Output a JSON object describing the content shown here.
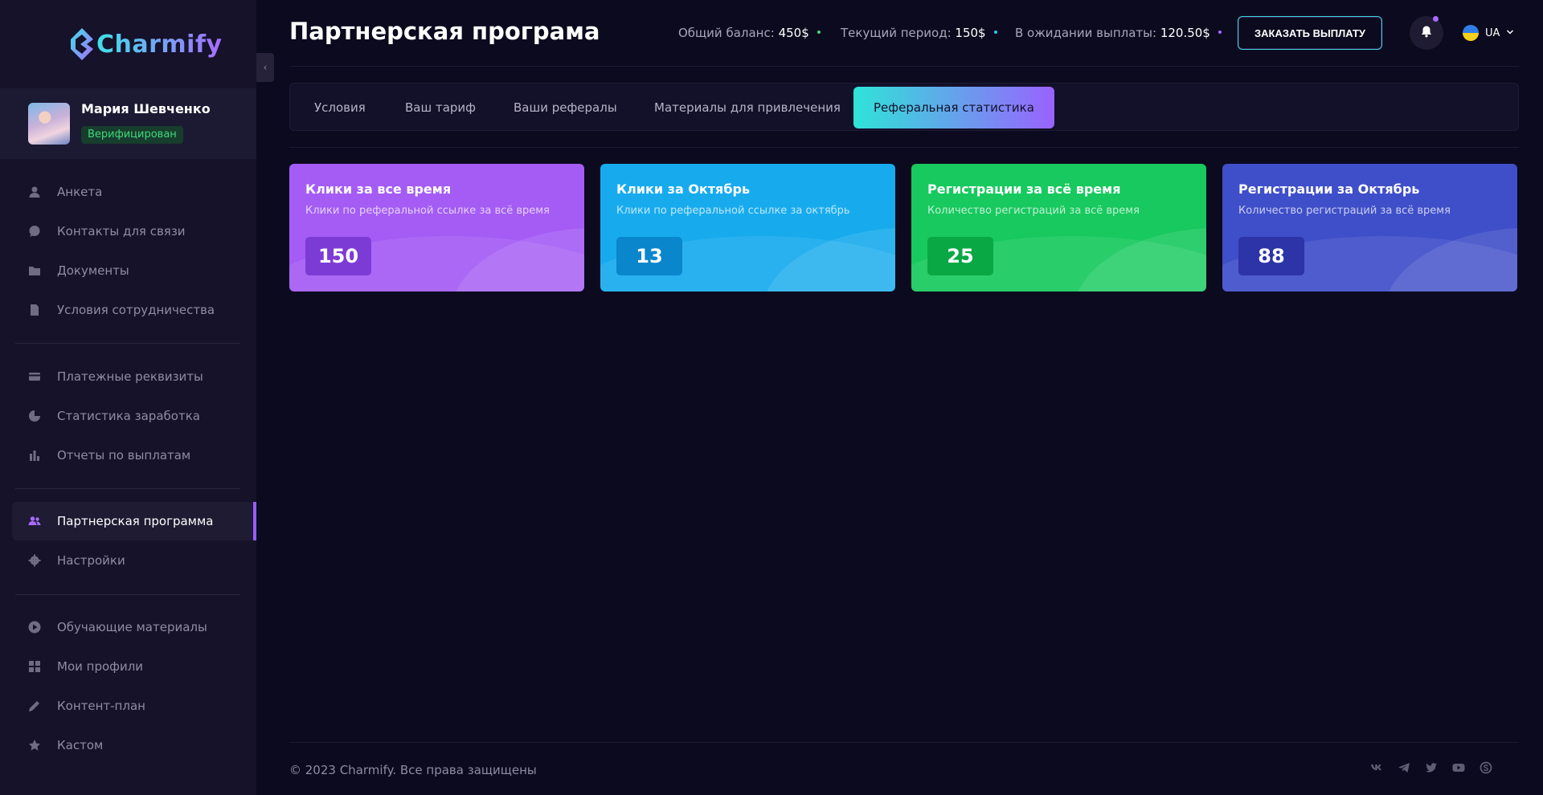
{
  "brand": {
    "name": "Charmify"
  },
  "user": {
    "name": "Мария Шевченко",
    "status": "Верифицирован"
  },
  "nav": {
    "items": [
      {
        "label": "Анкета",
        "icon": "user-icon"
      },
      {
        "label": "Контакты для связи",
        "icon": "chat-icon"
      },
      {
        "label": "Документы",
        "icon": "folder-icon"
      },
      {
        "label": "Условия сотрудничества",
        "icon": "file-icon"
      },
      {
        "label": "Платежные реквизиты",
        "icon": "card-icon"
      },
      {
        "label": "Статистика заработка",
        "icon": "pie-icon"
      },
      {
        "label": "Отчеты по выплатам",
        "icon": "bar-chart-icon"
      },
      {
        "label": "Партнерская программа",
        "icon": "users-icon",
        "active": true
      },
      {
        "label": "Настройки",
        "icon": "gear-icon"
      },
      {
        "label": "Обучающие материалы",
        "icon": "play-icon"
      },
      {
        "label": "Мои профили",
        "icon": "grid-icon"
      },
      {
        "label": "Контент-план",
        "icon": "pencil-icon"
      },
      {
        "label": "Кастом",
        "icon": "star-icon"
      }
    ]
  },
  "header": {
    "title": "Партнерская програма",
    "stats": [
      {
        "label": "Общий баланс:",
        "value": "450$",
        "dot_color": "#3fd97e"
      },
      {
        "label": "Текущий период:",
        "value": "150$",
        "dot_color": "#2fc8ee"
      },
      {
        "label": "В ожидании выплаты:",
        "value": "120.50$",
        "dot_color": "#a86bff"
      }
    ],
    "order_button": "ЗАКАЗАТЬ ВЫПЛАТУ",
    "language": "UA"
  },
  "tabs": [
    {
      "label": "Условия"
    },
    {
      "label": "Ваш тариф"
    },
    {
      "label": "Ваши рефералы"
    },
    {
      "label": "Материалы для привлечения"
    },
    {
      "label": "Реферальная статистика",
      "active": true
    }
  ],
  "cards": [
    {
      "title": "Клики за все время",
      "subtitle": "Клики по реферальной ссылке за всё время",
      "value": "150",
      "color": "#a45cf5",
      "value_bg": "#7d3bd6"
    },
    {
      "title": "Клики за Октябрь",
      "subtitle": "Клики по реферальной ссылке за октябрь",
      "value": "13",
      "color": "#17abee",
      "value_bg": "#0a86cc"
    },
    {
      "title": "Регистрации за всё время",
      "subtitle": "Количество регистраций за всё время",
      "value": "25",
      "color": "#17c95e",
      "value_bg": "#0aa845"
    },
    {
      "title": "Регистрации за Октябрь",
      "subtitle": "Количество регистраций за всё время",
      "value": "88",
      "color": "#3f4fc9",
      "value_bg": "#2c34a8"
    }
  ],
  "footer": {
    "copyright": "© 2023 Charmify. Все права защищены",
    "socials": [
      "vk-icon",
      "telegram-icon",
      "twitter-icon",
      "youtube-icon",
      "skype-icon"
    ]
  }
}
